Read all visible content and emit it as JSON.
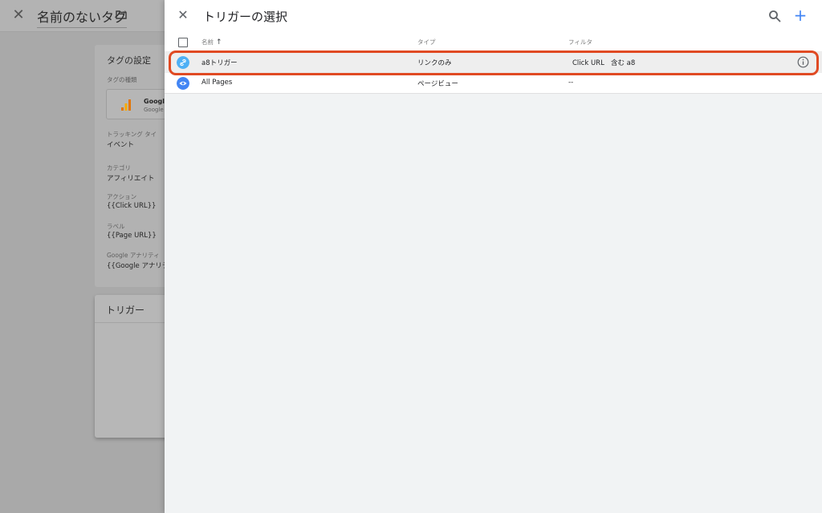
{
  "background": {
    "title": "名前のないタグ",
    "card": {
      "title": "タグの設定",
      "type_label": "タグの種類",
      "type_name": "Google",
      "type_sub": "Google",
      "tracking_label": "トラッキング タイ",
      "tracking_value": "イベント",
      "category_label": "カテゴリ",
      "category_value": "アフィリエイト",
      "action_label": "アクション",
      "action_value": "{{Click URL}}",
      "label_label": "ラベル",
      "label_value": "{{Page URL}}",
      "ga_label": "Google アナリティ",
      "ga_value": "{{Google アナリティ"
    },
    "trigger_card": {
      "title": "トリガー"
    }
  },
  "panel": {
    "title": "トリガーの選択",
    "columns": {
      "name": "名前",
      "type": "タイプ",
      "filter": "フィルタ"
    },
    "rows": [
      {
        "name": "a8トリガー",
        "type": "リンクのみ",
        "filter_var": "Click URL",
        "filter_op": "含む",
        "filter_val": "a8",
        "icon": "link-icon",
        "icon_color": "#4fb0f5",
        "selected": true
      },
      {
        "name": "All Pages",
        "type": "ページビュー",
        "filter": "--",
        "icon": "eye-icon",
        "icon_color": "#4285f4",
        "selected": false
      }
    ]
  },
  "colors": {
    "accent": "#4285f4",
    "highlight": "#e04a23"
  }
}
